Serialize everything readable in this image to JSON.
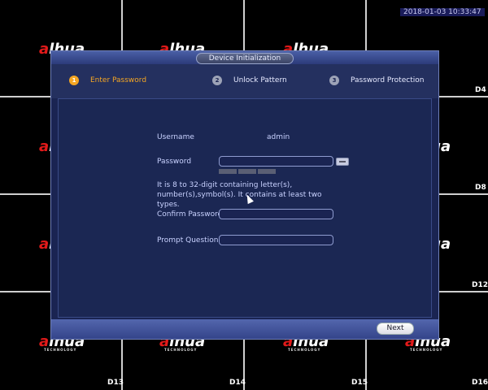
{
  "background": {
    "timestamp": "2018-01-03 10:33:47",
    "logo_text": "alhua",
    "logo_subtext": "TECHNOLOGY",
    "channel_labels": {
      "c4": "D4",
      "c8": "D8",
      "c12": "D12",
      "c13": "D13",
      "c14": "D14",
      "c15": "D15",
      "c16": "D16"
    }
  },
  "dialog": {
    "title": "Device Initialization",
    "steps": [
      {
        "num": "1",
        "label": "Enter Password"
      },
      {
        "num": "2",
        "label": "Unlock Pattern"
      },
      {
        "num": "3",
        "label": "Password Protection"
      }
    ],
    "form": {
      "username_label": "Username",
      "username_value": "admin",
      "password_label": "Password",
      "password_value": "",
      "hint": "It is 8 to 32-digit containing letter(s), number(s),symbol(s). It contains at least two types.",
      "confirm_label": "Confirm Password",
      "confirm_value": "",
      "question_label": "Prompt Question",
      "question_value": ""
    },
    "next_label": "Next"
  },
  "colors": {
    "active_step": "#f5a623",
    "dialog_bg": "#1a2452",
    "logo_red": "#e21a1a"
  }
}
